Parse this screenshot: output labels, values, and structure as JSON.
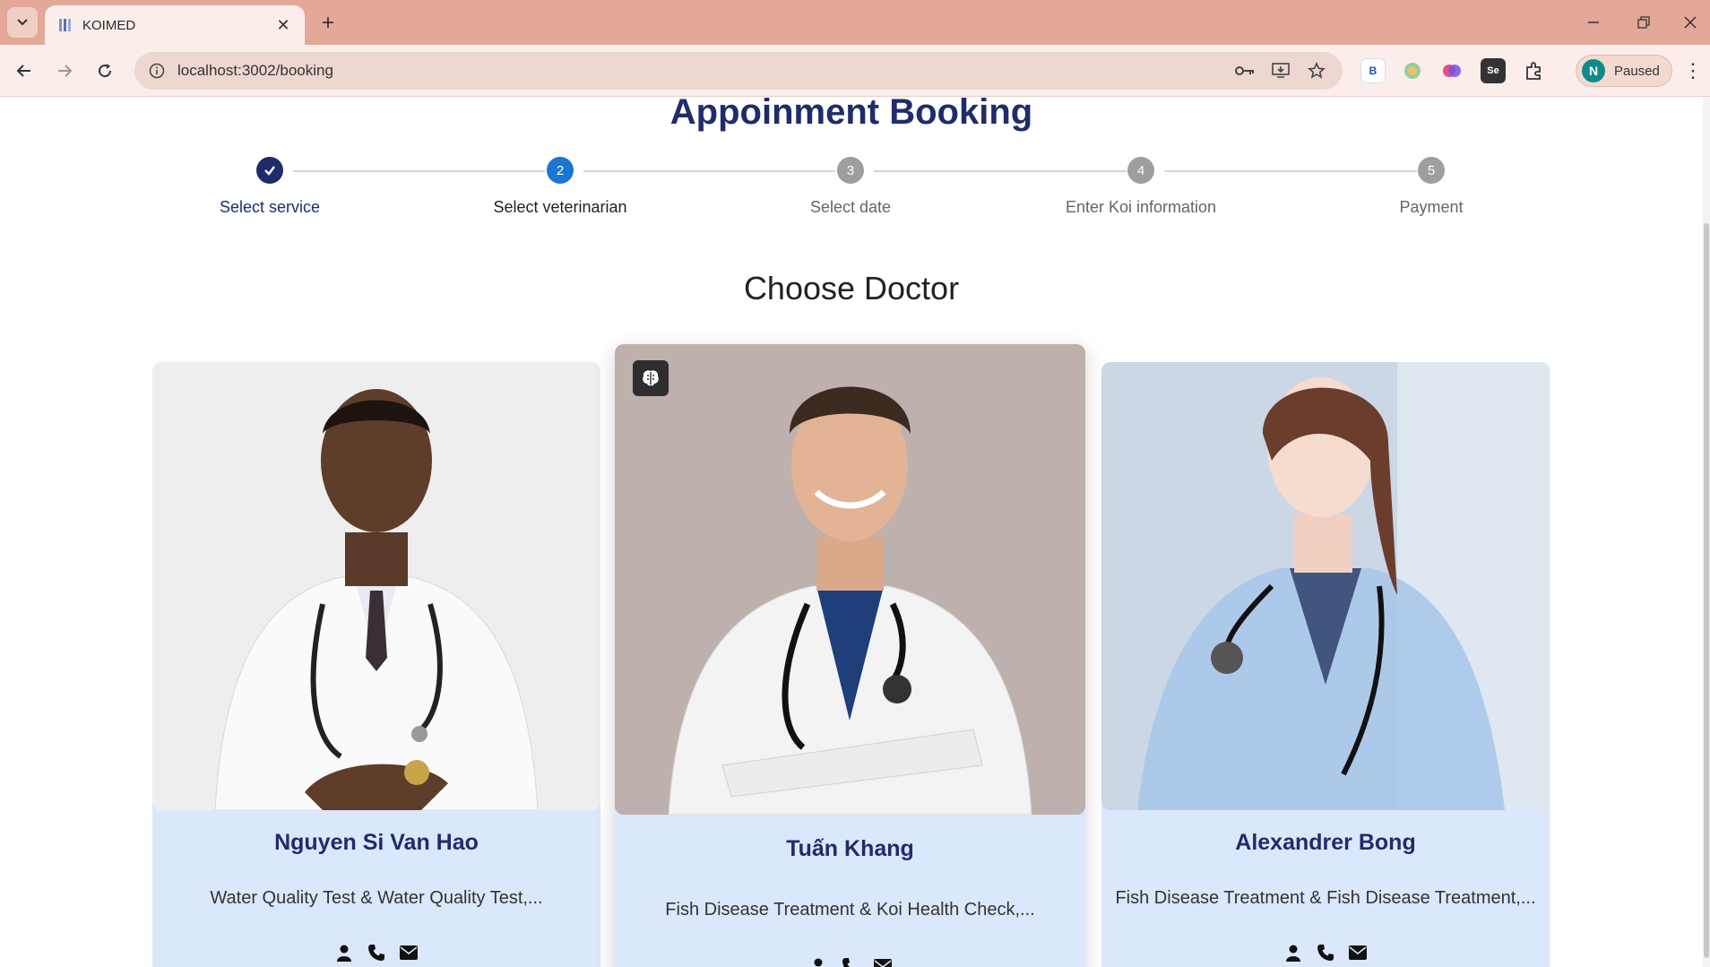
{
  "browser": {
    "tab_title": "KOIMED",
    "url": "localhost:3002/booking",
    "profile_initial": "N",
    "profile_status": "Paused",
    "extension_b_label": "B",
    "extension_se_label": "Se"
  },
  "page": {
    "title": "Appoinment Booking",
    "section_title": "Choose Doctor"
  },
  "steps": [
    {
      "number": "1",
      "label": "Select service",
      "state": "done"
    },
    {
      "number": "2",
      "label": "Select veterinarian",
      "state": "active"
    },
    {
      "number": "3",
      "label": "Select date",
      "state": "todo"
    },
    {
      "number": "4",
      "label": "Enter Koi information",
      "state": "todo"
    },
    {
      "number": "5",
      "label": "Payment",
      "state": "todo"
    }
  ],
  "doctors": [
    {
      "name": "Nguyen Si Van Hao",
      "services": "Water Quality Test & Water Quality Test,..."
    },
    {
      "name": "Tuấn Khang",
      "services": "Fish Disease Treatment & Koi Health Check,..."
    },
    {
      "name": "Alexandrer Bong",
      "services": "Fish Disease Treatment & Fish Disease Treatment,..."
    }
  ],
  "colors": {
    "brand_navy": "#1f2c6b",
    "step_active": "#1976d2",
    "step_todo": "#9e9e9e",
    "card_bg": "#dbe7fb",
    "chrome_tabstrip": "#e3a897"
  }
}
